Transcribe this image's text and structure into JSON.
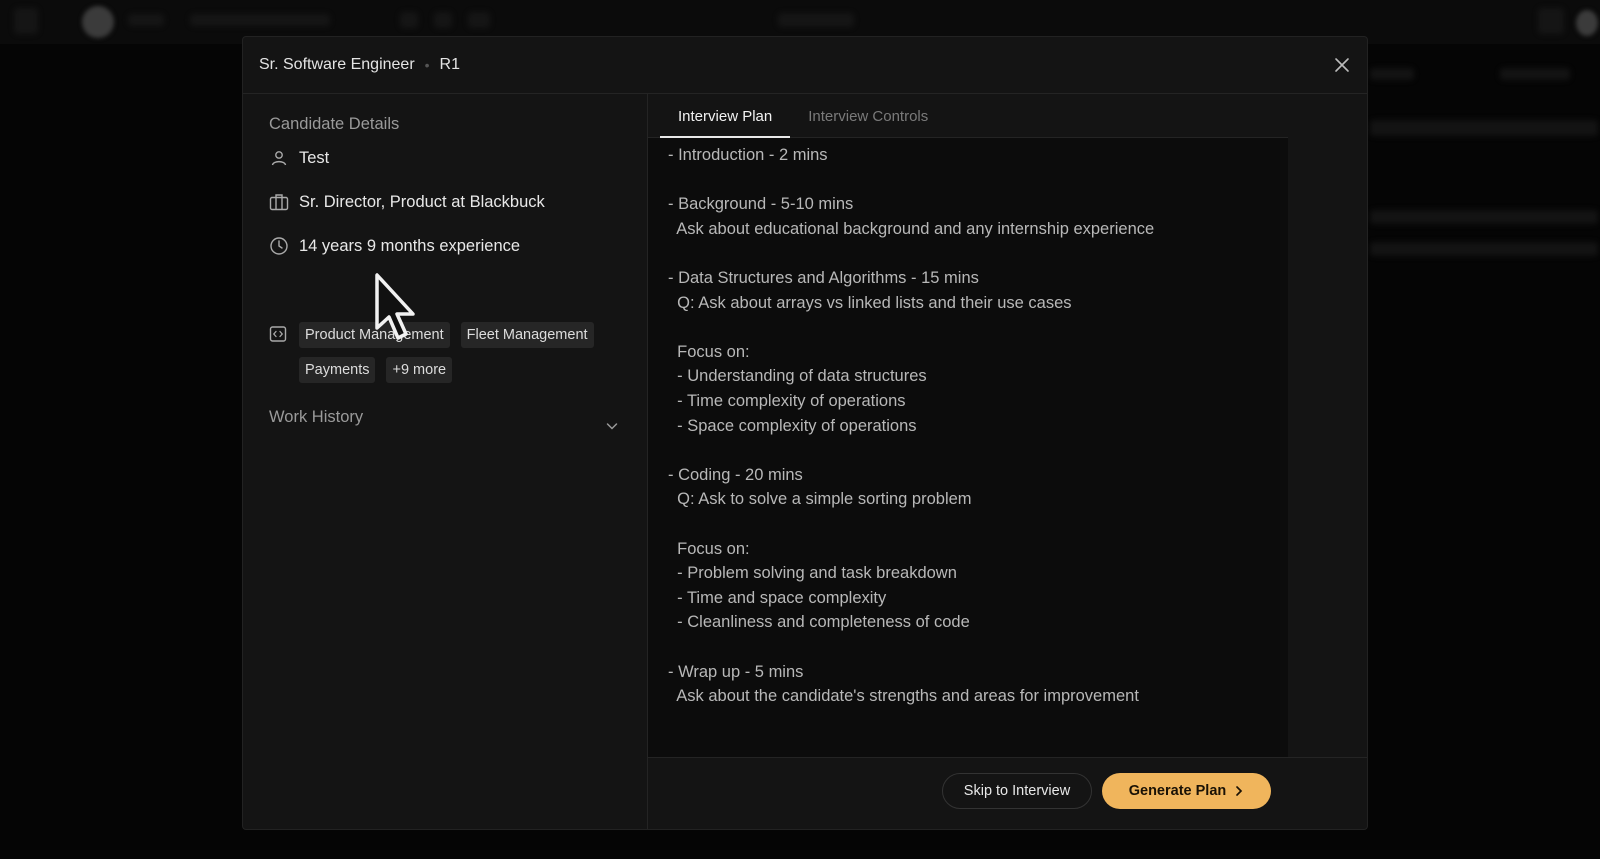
{
  "modal": {
    "title": "Sr. Software Engineer",
    "separator": "•",
    "round": "R1"
  },
  "candidate": {
    "section_title": "Candidate Details",
    "name": "Test",
    "role": "Sr. Director, Product at Blackbuck",
    "experience": "14 years 9 months experience",
    "skills": [
      "Product Management",
      "Fleet Management",
      "Payments",
      "+9 more"
    ],
    "work_history_title": "Work History"
  },
  "tabs": [
    {
      "label": "Interview Plan",
      "active": true
    },
    {
      "label": "Interview Controls",
      "active": false
    }
  ],
  "plan_lines": [
    "- Introduction - 2 mins",
    "",
    "- Background - 5-10 mins",
    "  Ask about educational background and any internship experience",
    "",
    "- Data Structures and Algorithms - 15 mins",
    "  Q: Ask about arrays vs linked lists and their use cases",
    "",
    "  Focus on:",
    "  - Understanding of data structures",
    "  - Time complexity of operations",
    "  - Space complexity of operations",
    "",
    "- Coding - 20 mins",
    "  Q: Ask to solve a simple sorting problem",
    "",
    "  Focus on:",
    "  - Problem solving and task breakdown",
    "  - Time and space complexity",
    "  - Cleanliness and completeness of code",
    "",
    "- Wrap up - 5 mins",
    "  Ask about the candidate's strengths and areas for improvement"
  ],
  "footer": {
    "skip_label": "Skip to Interview",
    "generate_label": "Generate Plan"
  },
  "icons": {
    "name": "user-icon",
    "role": "briefcase-icon",
    "experience": "clock-icon",
    "skills": "code-icon",
    "expand": "chevron-down-icon",
    "close": "close-icon",
    "generate_arrow": "chevron-right-icon"
  },
  "colors": {
    "accent": "#f0b55c",
    "modal_bg": "#141414",
    "plan_bg": "#0c0c0c"
  }
}
